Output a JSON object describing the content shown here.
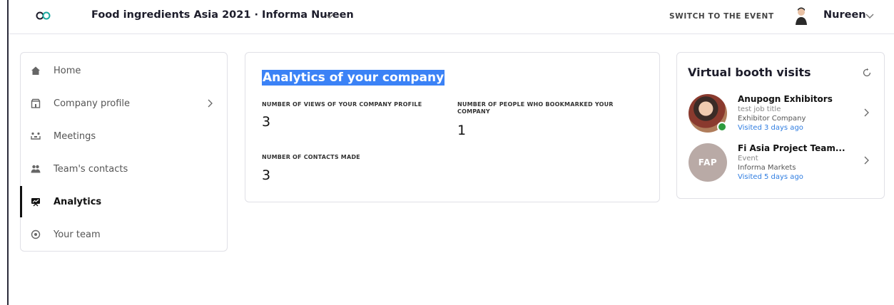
{
  "header": {
    "event_title": "Food ingredients Asia 2021 · Informa Nureen",
    "switch_label": "SWITCH TO THE EVENT",
    "user_name": "Nureen"
  },
  "sidebar": {
    "items": [
      {
        "label": "Home",
        "icon": "home-icon"
      },
      {
        "label": "Company profile",
        "icon": "company-icon"
      },
      {
        "label": "Meetings",
        "icon": "meetings-icon"
      },
      {
        "label": "Team's contacts",
        "icon": "contacts-icon"
      },
      {
        "label": "Analytics",
        "icon": "analytics-icon",
        "active": true
      },
      {
        "label": "Your team",
        "icon": "team-icon"
      }
    ]
  },
  "analytics": {
    "title": "Analytics of your company",
    "stats": [
      {
        "label": "NUMBER OF VIEWS OF YOUR COMPANY PROFILE",
        "value": "3"
      },
      {
        "label_line1": "NUMBER OF PEOPLE WHO BOOKMARKED YOUR",
        "label_line2": "COMPANY",
        "value": "1"
      },
      {
        "label": "NUMBER OF CONTACTS MADE",
        "value": "3"
      }
    ]
  },
  "visits": {
    "title": "Virtual booth visits",
    "visitors": [
      {
        "name": "Anupogn Exhibitors",
        "job": "test job title",
        "company": "Exhibitor Company",
        "visited": "Visited 3 days ago",
        "online": true
      },
      {
        "name": "Fi Asia Project Team...",
        "initials": "FAP",
        "job": "Event",
        "company": "Informa Markets",
        "visited": "Visited 5 days ago",
        "online": false
      }
    ]
  },
  "colors": {
    "accent": "#3b82f6",
    "link": "#2f7de1",
    "online": "#2e9b3e",
    "logo": "#1aa9a0"
  }
}
